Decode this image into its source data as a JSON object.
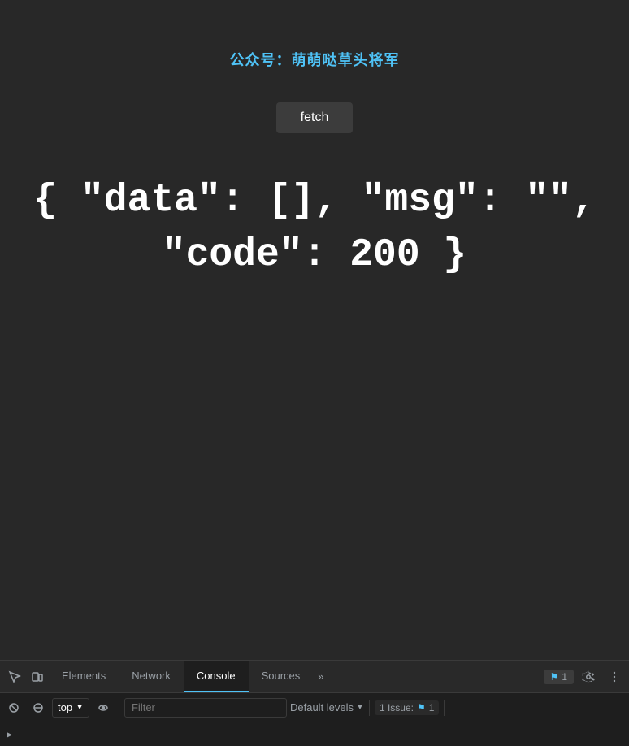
{
  "main": {
    "wechat_prefix": "公众号：",
    "wechat_name": "萌萌哒草头将军",
    "fetch_button": "fetch",
    "json_line1": "{ \"data\": [], \"msg\": \"\",",
    "json_line2": "\"code\": 200 }"
  },
  "devtools": {
    "tabs": [
      {
        "label": "Elements",
        "active": false
      },
      {
        "label": "Network",
        "active": false
      },
      {
        "label": "Console",
        "active": true
      },
      {
        "label": "Sources",
        "active": false
      }
    ],
    "more_tabs": "»",
    "issue_count": "1",
    "console_bar": {
      "top_label": "top",
      "filter_placeholder": "Filter",
      "default_levels": "Default levels",
      "issue_text": "1 Issue:",
      "issue_num": "1"
    },
    "colors": {
      "active_tab_border": "#4fc3f7",
      "flag_color": "#4fc3f7"
    }
  }
}
